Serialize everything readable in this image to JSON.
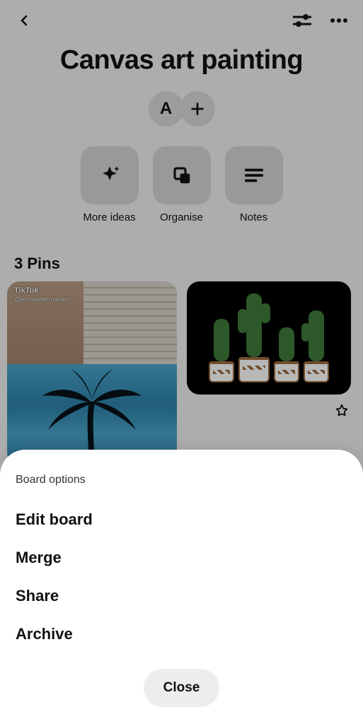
{
  "header": {
    "title": "Canvas art painting",
    "initial": "A"
  },
  "tiles": {
    "ideas": "More ideas",
    "organise": "Organise",
    "notes": "Notes"
  },
  "pins_header": "3 Pins",
  "pin1_watermark_top": "TikTok",
  "pin1_watermark_user": "@jennashermanart",
  "sheet": {
    "title": "Board options",
    "edit": "Edit board",
    "merge": "Merge",
    "share": "Share",
    "archive": "Archive",
    "close": "Close"
  }
}
